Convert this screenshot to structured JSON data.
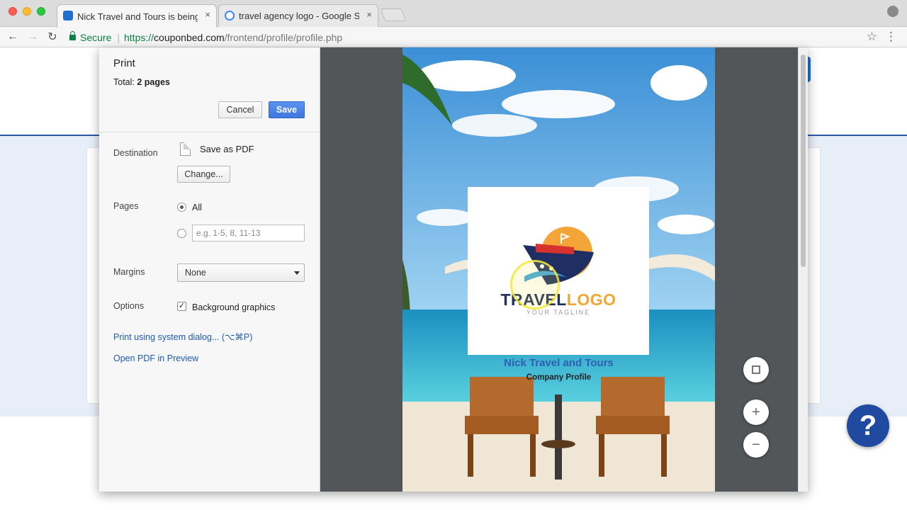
{
  "browser": {
    "tabs": [
      {
        "label": "Nick Travel and Tours is being",
        "close": "×"
      },
      {
        "label": "travel agency logo - Google Se",
        "close": "×"
      }
    ],
    "secure_label": "Secure",
    "url_scheme": "https://",
    "url_host": "couponbed.com",
    "url_path": "/frontend/profile/profile.php"
  },
  "print": {
    "title": "Print",
    "total_label": "Total:",
    "total_value": "2 pages",
    "cancel": "Cancel",
    "save": "Save",
    "destination_label": "Destination",
    "destination_value": "Save as PDF",
    "change": "Change...",
    "pages_label": "Pages",
    "pages_all": "All",
    "pages_placeholder": "e.g. 1-5, 8, 11-13",
    "margins_label": "Margins",
    "margins_value": "None",
    "options_label": "Options",
    "background_graphics": "Background graphics",
    "background_graphics_checked": true,
    "link_system_dialog": "Print using system dialog... (⌥⌘P)",
    "link_open_pdf": "Open PDF in Preview"
  },
  "preview": {
    "logo_word1": "TRAVEL",
    "logo_word2": "LOGO",
    "tagline": "YOUR TAGLINE",
    "company_name": "Nick Travel and Tours",
    "company_subtitle": "Company Profile"
  },
  "help": {
    "label": "?"
  },
  "colors": {
    "accent": "#3e77de",
    "link": "#1c5bb5",
    "brand_navy": "#1f4aa0"
  }
}
